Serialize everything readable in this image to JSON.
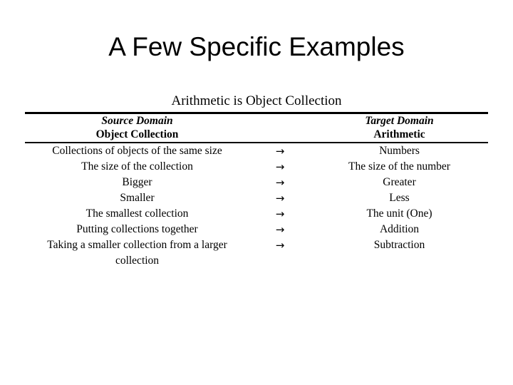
{
  "slide": {
    "title": "A Few Specific Examples",
    "caption": "Arithmetic is Object Collection"
  },
  "table": {
    "header": {
      "source_domain_label": "Source Domain",
      "source_domain_name": "Object Collection",
      "target_domain_label": "Target Domain",
      "target_domain_name": "Arithmetic"
    },
    "arrow_glyph": "→",
    "rows": [
      {
        "source": "Collections of objects of the same size",
        "arrow": "→",
        "target": "Numbers"
      },
      {
        "source": "The size of the collection",
        "arrow": "→",
        "target": "The size of the number"
      },
      {
        "source": "Bigger",
        "arrow": "→",
        "target": "Greater"
      },
      {
        "source": "Smaller",
        "arrow": "→",
        "target": "Less"
      },
      {
        "source": "The smallest collection",
        "arrow": "→",
        "target": "The unit (One)"
      },
      {
        "source": "Putting collections together",
        "arrow": "→",
        "target": "Addition"
      },
      {
        "source": "Taking a smaller collection from a larger collection",
        "arrow": "→",
        "target": "Subtraction"
      }
    ]
  },
  "colors": {
    "text": "#000000",
    "background": "#ffffff",
    "rule": "#000000"
  }
}
